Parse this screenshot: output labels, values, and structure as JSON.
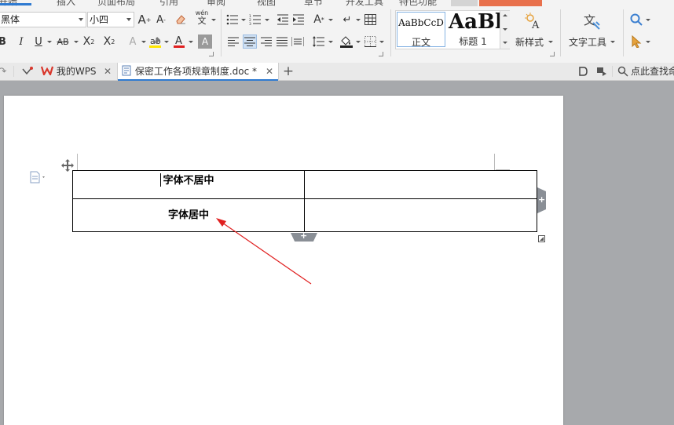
{
  "ribbon": {
    "font_name": "黑体",
    "font_size": "小四",
    "wen_icon_label": "wén",
    "styles": [
      {
        "preview": "AaBbCcD",
        "name": "正文"
      },
      {
        "preview": "AaBl",
        "name": "标题 1"
      }
    ],
    "new_style_label": "新样式",
    "text_tools_label": "文字工具"
  },
  "menu_fragments": [
    "开始",
    "插入",
    "页面布局",
    "引用",
    "审阅",
    "视图",
    "章节",
    "开发工具",
    "特色功能"
  ],
  "tabs": {
    "home_tab": "我的WPS",
    "doc_tab": "保密工作各项规章制度.doc *",
    "search_label": "点此查找命"
  },
  "document": {
    "table": [
      [
        "字体不居中",
        ""
      ],
      [
        "字体居中",
        ""
      ]
    ]
  },
  "colors": {
    "accent": "#2e7ad1",
    "annotation_arrow": "#e02020",
    "wps_red": "#d9362b"
  }
}
